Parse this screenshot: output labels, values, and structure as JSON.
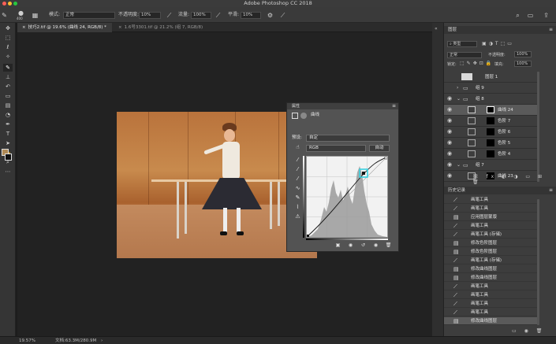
{
  "app": {
    "title": "Adobe Photoshop CC 2018"
  },
  "options": {
    "brush_size": "400",
    "mode_label": "模式:",
    "mode_value": "正常",
    "opacity_label": "不透明度:",
    "opacity_value": "10%",
    "flow_label": "流量:",
    "flow_value": "100%",
    "smooth_label": "平滑:",
    "smooth_value": "10%"
  },
  "tabs": [
    {
      "label": "技巧2.tif @ 19.6% (曲线 24, RGB/8) *"
    },
    {
      "label": "1.6号3301.tif @ 21.2% (组 7, RGB/8)"
    }
  ],
  "properties": {
    "tab_label": "属性",
    "type_label": "曲线",
    "preset_label": "预设:",
    "preset_value": "自定",
    "channel_value": "RGB",
    "auto_label": "自动"
  },
  "layers_panel": {
    "tab_label": "图层",
    "kind_value": "类型",
    "blend_value": "正常",
    "opacity_label": "不透明度:",
    "opacity_value": "100%",
    "lock_label": "锁定:",
    "fill_label": "填充:",
    "fill_value": "100%",
    "layers": [
      {
        "name": "图层 1"
      },
      {
        "name": "组 9"
      },
      {
        "name": "组 8"
      },
      {
        "name": "曲线 24"
      },
      {
        "name": "色阶 7"
      },
      {
        "name": "色阶 6"
      },
      {
        "name": "色阶 5"
      },
      {
        "name": "色阶 4"
      },
      {
        "name": "组 7"
      },
      {
        "name": "曲线 23"
      }
    ]
  },
  "history_panel": {
    "tab_label": "历史记录",
    "items": [
      {
        "name": "画笔工具"
      },
      {
        "name": "画笔工具"
      },
      {
        "name": "应用图层蒙版"
      },
      {
        "name": "画笔工具"
      },
      {
        "name": "画笔工具 (存储)"
      },
      {
        "name": "修改色阶图层"
      },
      {
        "name": "修改色阶图层"
      },
      {
        "name": "画笔工具 (存储)"
      },
      {
        "name": "修改曲线图层"
      },
      {
        "name": "修改曲线图层"
      },
      {
        "name": "画笔工具"
      },
      {
        "name": "画笔工具"
      },
      {
        "name": "画笔工具"
      },
      {
        "name": "画笔工具"
      },
      {
        "name": "修改曲线图层"
      }
    ]
  },
  "status": {
    "zoom": "19.57%",
    "doc_info": "文档:63.3M/280.9M"
  },
  "colors": {
    "foreground": "#b08a55",
    "background": "#111111",
    "accent": "#3ad0e0"
  }
}
